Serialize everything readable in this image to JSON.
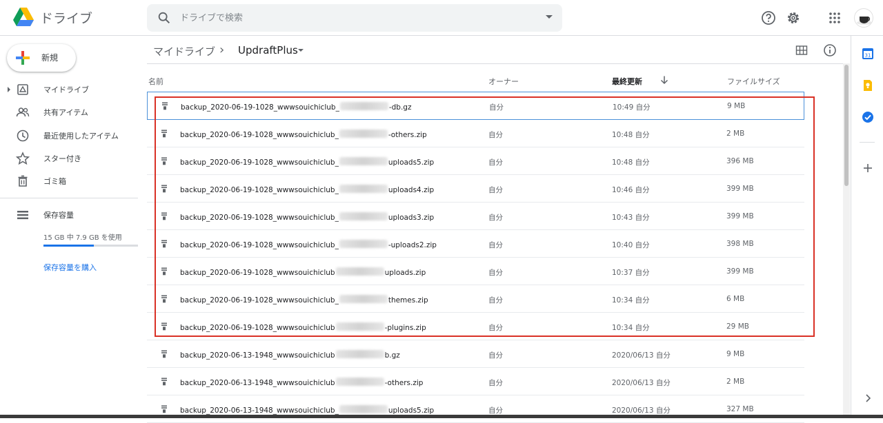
{
  "app": {
    "title": "ドライブ"
  },
  "search": {
    "placeholder": "ドライブで検索"
  },
  "sidebar": {
    "new_label": "新規",
    "items": [
      {
        "label": "マイドライブ",
        "icon": "my-drive-icon"
      },
      {
        "label": "共有アイテム",
        "icon": "shared-icon"
      },
      {
        "label": "最近使用したアイテム",
        "icon": "recent-icon"
      },
      {
        "label": "スター付き",
        "icon": "star-icon"
      },
      {
        "label": "ゴミ箱",
        "icon": "trash-icon"
      }
    ],
    "storage_label": "保存容量",
    "storage_usage": "15 GB 中 7.9 GB を使用",
    "storage_used_fraction": 0.53,
    "buy_storage": "保存容量を購入"
  },
  "breadcrumb": {
    "root": "マイドライブ",
    "current": "UpdraftPlus"
  },
  "columns": {
    "name": "名前",
    "owner": "オーナー",
    "modified": "最終更新",
    "size": "ファイルサイズ"
  },
  "files": [
    {
      "prefix": "backup_2020-06-19-1028_wwwsouichiclub_",
      "suffix": "-db.gz",
      "owner": "自分",
      "modified": "10:49 自分",
      "size": "9 MB"
    },
    {
      "prefix": "backup_2020-06-19-1028_wwwsouichiclub_",
      "suffix": "-others.zip",
      "owner": "自分",
      "modified": "10:48 自分",
      "size": "2 MB"
    },
    {
      "prefix": "backup_2020-06-19-1028_wwwsouichiclub_",
      "suffix": "uploads5.zip",
      "owner": "自分",
      "modified": "10:48 自分",
      "size": "396 MB"
    },
    {
      "prefix": "backup_2020-06-19-1028_wwwsouichiclub_",
      "suffix": "uploads4.zip",
      "owner": "自分",
      "modified": "10:46 自分",
      "size": "399 MB"
    },
    {
      "prefix": "backup_2020-06-19-1028_wwwsouichiclub_",
      "suffix": "uploads3.zip",
      "owner": "自分",
      "modified": "10:43 自分",
      "size": "399 MB"
    },
    {
      "prefix": "backup_2020-06-19-1028_wwwsouichiclub_",
      "suffix": "-uploads2.zip",
      "owner": "自分",
      "modified": "10:40 自分",
      "size": "398 MB"
    },
    {
      "prefix": "backup_2020-06-19-1028_wwwsouichiclub",
      "suffix": "uploads.zip",
      "owner": "自分",
      "modified": "10:37 自分",
      "size": "399 MB"
    },
    {
      "prefix": "backup_2020-06-19-1028_wwwsouichiclub_",
      "suffix": "themes.zip",
      "owner": "自分",
      "modified": "10:34 自分",
      "size": "6 MB"
    },
    {
      "prefix": "backup_2020-06-19-1028_wwwsouichiclub",
      "suffix": "-plugins.zip",
      "owner": "自分",
      "modified": "10:34 自分",
      "size": "29 MB"
    },
    {
      "prefix": "backup_2020-06-13-1948_wwwsouichiclub",
      "suffix": "b.gz",
      "owner": "自分",
      "modified": "2020/06/13 自分",
      "size": "9 MB"
    },
    {
      "prefix": "backup_2020-06-13-1948_wwwsouichiclub",
      "suffix": "-others.zip",
      "owner": "自分",
      "modified": "2020/06/13 自分",
      "size": "2 MB"
    },
    {
      "prefix": "backup_2020-06-13-1948_wwwsouichiclub_",
      "suffix": "uploads5.zip",
      "owner": "自分",
      "modified": "2020/06/13 自分",
      "size": "327 MB"
    }
  ],
  "colors": {
    "accent": "#1a73e8",
    "highlight": "#d93025",
    "selection": "#4a90d9"
  }
}
